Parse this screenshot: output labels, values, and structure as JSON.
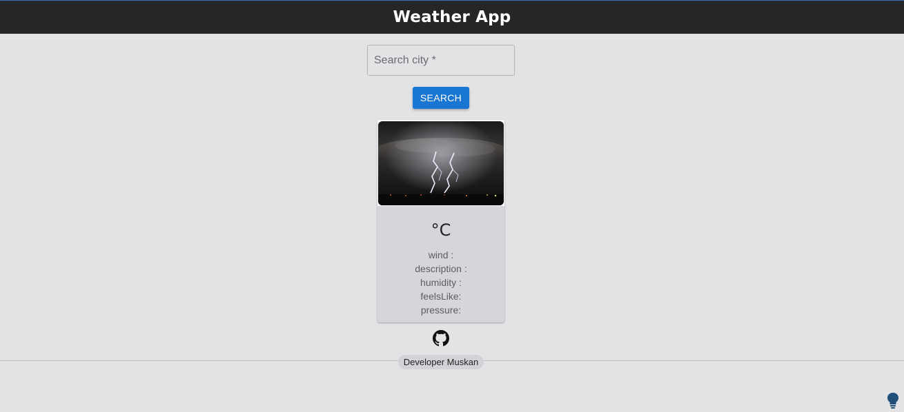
{
  "appbar": {
    "title": "Weather App"
  },
  "search": {
    "placeholder": "Search city *",
    "button_label": "SEARCH"
  },
  "card": {
    "temperature_unit": "°C",
    "details": [
      "wind :",
      "description :",
      "humidity :",
      "feelsLike:",
      "pressure:"
    ],
    "image": "lightning-storm-night"
  },
  "footer": {
    "developer_chip": "Developer Muskan",
    "github_icon": "github-icon",
    "idea_icon": "lightbulb-icon"
  },
  "colors": {
    "appbar": "#262629",
    "background": "#e3e3e6",
    "primary": "#1976d2",
    "card": "#d6d6da",
    "bulb": "#1f4f7a"
  }
}
